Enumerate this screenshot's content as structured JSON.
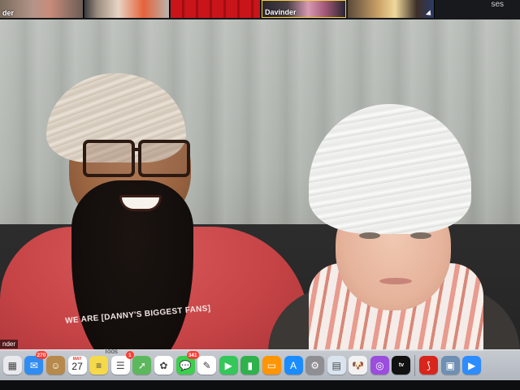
{
  "gallery": {
    "tiles": [
      {
        "name": "der"
      },
      {
        "name": ""
      },
      {
        "name": ""
      },
      {
        "name": "Davinder"
      },
      {
        "name": ""
      }
    ],
    "right_text": "ses"
  },
  "main_video": {
    "name_label": "nder",
    "shirt_text": "WE ARE [DANNY'S BIGGEST FANS]"
  },
  "dock": {
    "label_under_icon": "Toos",
    "icons": [
      {
        "name": "launchpad-icon",
        "color": "#e9e9ee",
        "glyph": "▦"
      },
      {
        "name": "mail-icon",
        "color": "#2f8cf2",
        "glyph": "✉",
        "badge": "270"
      },
      {
        "name": "contacts-icon",
        "color": "#b7894a",
        "glyph": "☺"
      },
      {
        "name": "calendar-icon",
        "color": "#ffffff",
        "month": "MAY",
        "day": "27"
      },
      {
        "name": "notes-icon",
        "color": "#f5d94a",
        "glyph": "≡"
      },
      {
        "name": "reminders-icon",
        "color": "#ffffff",
        "glyph": "☰",
        "badge": "1"
      },
      {
        "name": "maps-icon",
        "color": "#5cb85c",
        "glyph": "➚"
      },
      {
        "name": "photos-icon",
        "color": "#ffffff",
        "glyph": "✿"
      },
      {
        "name": "messages-icon",
        "color": "#3ccf4e",
        "glyph": "💬",
        "badge": "341"
      },
      {
        "name": "freeform-icon",
        "color": "#ffffff",
        "glyph": "✎"
      },
      {
        "name": "facetime-icon",
        "color": "#34c759",
        "glyph": "▶"
      },
      {
        "name": "numbers-icon",
        "color": "#2fb24c",
        "glyph": "▮"
      },
      {
        "name": "books-icon",
        "color": "#ff9500",
        "glyph": "▭"
      },
      {
        "name": "app-store-icon",
        "color": "#1a8cff",
        "glyph": "A"
      },
      {
        "name": "system-settings-icon",
        "color": "#8e8e93",
        "glyph": "⚙"
      },
      {
        "name": "preview-icon",
        "color": "#d9e4ef",
        "glyph": "▤"
      },
      {
        "name": "pet-app-icon",
        "color": "#f2f2f2",
        "glyph": "🐶"
      },
      {
        "name": "podcasts-icon",
        "color": "#9b4dde",
        "glyph": "◎"
      },
      {
        "name": "apple-tv-icon",
        "color": "#111111",
        "glyph": "tv"
      },
      {
        "name": "acrobat-icon",
        "color": "#d8261c",
        "glyph": "⟆"
      },
      {
        "name": "finder-window-icon",
        "color": "#6f8fb3",
        "glyph": "▣"
      },
      {
        "name": "zoom-icon",
        "color": "#2d8cff",
        "glyph": "▶"
      }
    ],
    "separator_after_index": 18
  }
}
